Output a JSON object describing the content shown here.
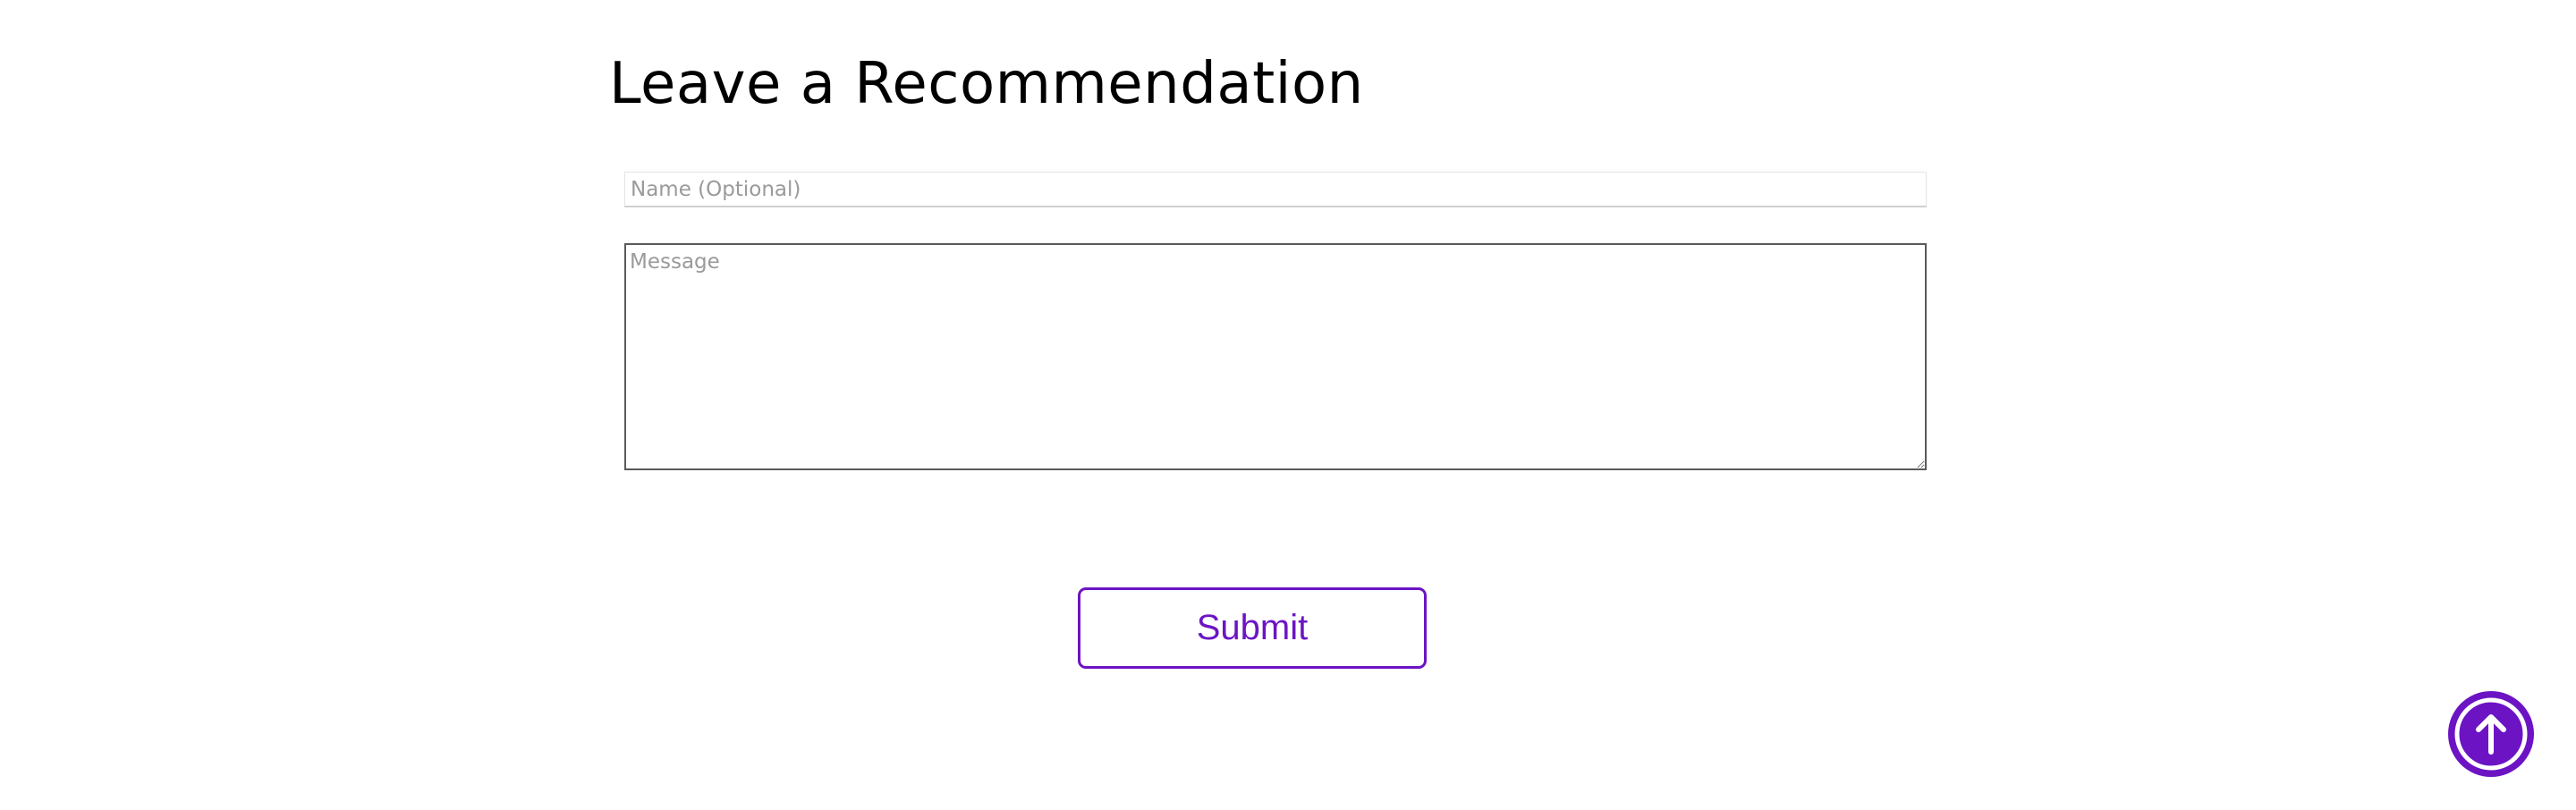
{
  "recommendation_form": {
    "title": "Leave a Recommendation",
    "name_placeholder": "Name (Optional)",
    "name_value": "",
    "message_placeholder": "Message",
    "message_value": "",
    "submit_label": "Submit"
  },
  "scroll_top": {
    "icon": "arrow-up-circle-icon"
  },
  "colors": {
    "accent": "#6c14c4",
    "background": "#ffffff",
    "text": "#000000",
    "placeholder": "#9a9a9a"
  }
}
